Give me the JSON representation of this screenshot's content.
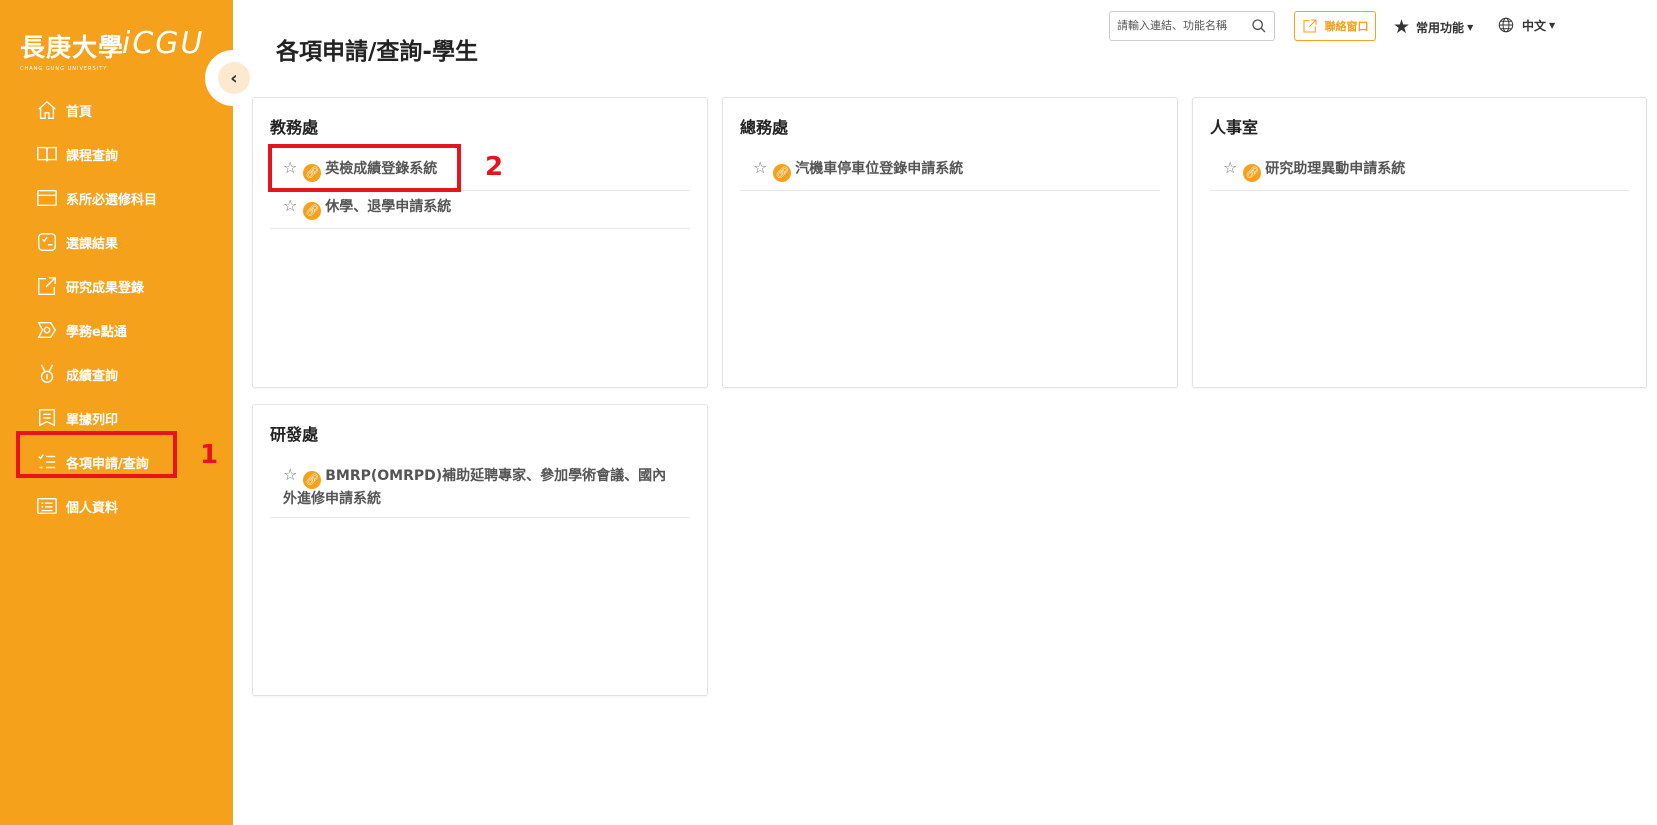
{
  "brand": {
    "name_zh": "長庚大學",
    "name_en": "CHANG GUNG UNIVERSITY",
    "system": "iCGU"
  },
  "sidebar": {
    "collapse_icon": "chevron-left-icon",
    "items": [
      {
        "label": "首頁",
        "icon": "home-icon"
      },
      {
        "label": "課程查詢",
        "icon": "book-icon"
      },
      {
        "label": "系所必選修科目",
        "icon": "window-icon"
      },
      {
        "label": "選課結果",
        "icon": "checklist-icon"
      },
      {
        "label": "研究成果登錄",
        "icon": "external-link-icon"
      },
      {
        "label": "學務e點通",
        "icon": "e-badge-icon"
      },
      {
        "label": "成績查詢",
        "icon": "medal-icon"
      },
      {
        "label": "單據列印",
        "icon": "receipt-icon"
      },
      {
        "label": "各項申請/查詢",
        "icon": "list-icon"
      },
      {
        "label": "個人資料",
        "icon": "profile-list-icon"
      }
    ]
  },
  "header": {
    "title": "各項申請/查詢-學生",
    "search_placeholder": "請輸入連結、功能名稱",
    "contact_label": "聯絡窗口",
    "favorites_label": "常用功能",
    "language_label": "中文"
  },
  "cards": [
    {
      "title": "教務處",
      "items": [
        "英檢成績登錄系統",
        "休學、退學申請系統"
      ]
    },
    {
      "title": "總務處",
      "items": [
        "汽機車停車位登錄申請系統"
      ]
    },
    {
      "title": "人事室",
      "items": [
        "研究助理異動申請系統"
      ]
    },
    {
      "title": "研發處",
      "items": [
        "BMRP(OMRPD)補助延聘專家、參加學術會議、國內外進修申請系統"
      ]
    }
  ],
  "annotations": {
    "marker1": "1",
    "marker2": "2"
  },
  "colors": {
    "sidebar": "#f5a11c",
    "highlight": "#e8141c",
    "accent": "#f5a11c"
  }
}
